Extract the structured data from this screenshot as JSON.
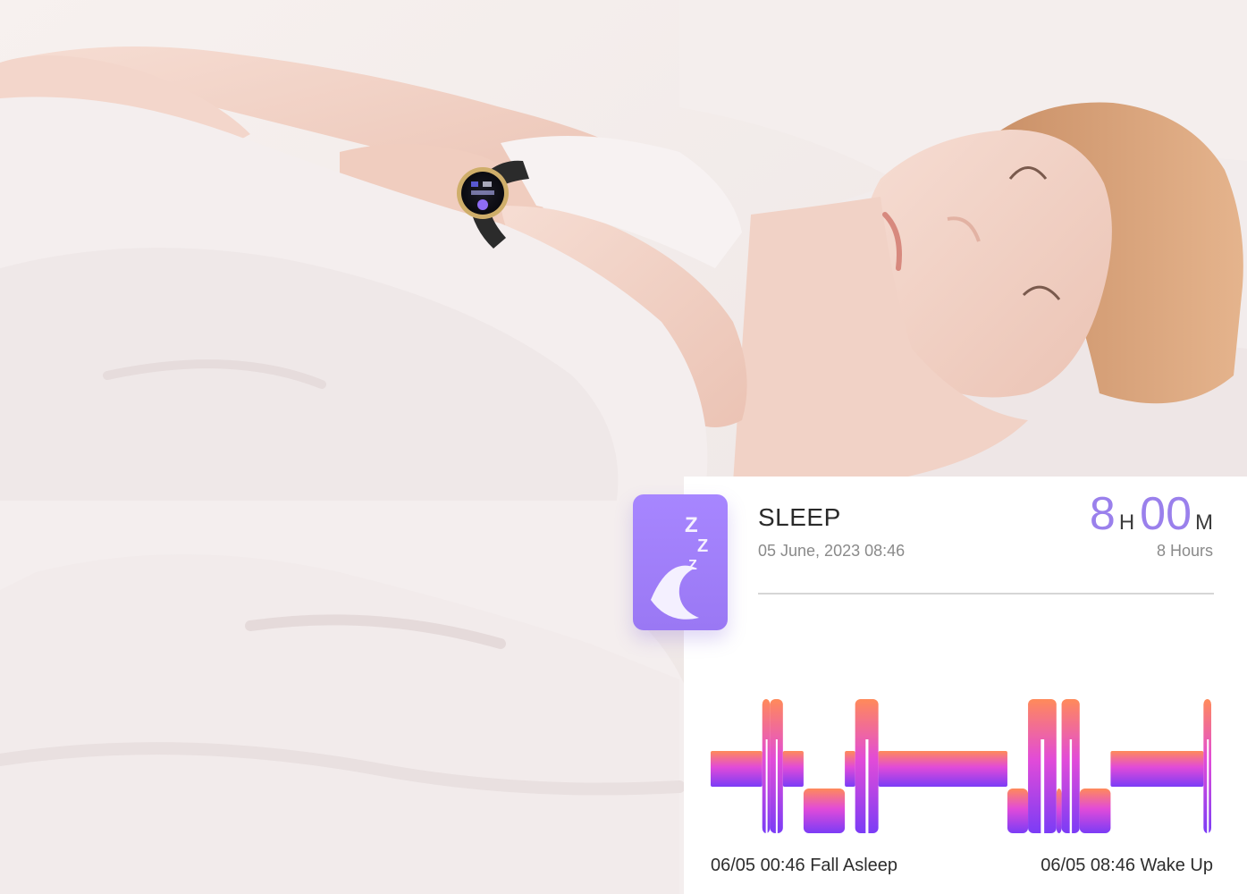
{
  "sleep_card": {
    "title": "SLEEP",
    "date": "05 June, 2023 08:46",
    "hours_value": "8",
    "hours_unit": "H",
    "minutes_value": "00",
    "minutes_unit": "M",
    "duration_text": "8 Hours",
    "fall_asleep_label": "06/05 00:46 Fall Asleep",
    "wake_up_label": "06/05 08:46 Wake Up"
  },
  "colors": {
    "accent_purple": "#9a80ec",
    "badge_purple": "#a786ff",
    "chart_top": "#ff8a5a",
    "chart_mid": "#e24bd8",
    "chart_bottom": "#7b3cf6"
  },
  "icons": {
    "badge": "moon-sleep-icon",
    "watch": "smartwatch"
  },
  "chart_data": {
    "type": "area",
    "stages_order_top_to_bottom": [
      "awake",
      "light",
      "deep"
    ],
    "segments": [
      {
        "stage": "light",
        "duration": 0.1
      },
      {
        "stage": "awake",
        "duration": 0.015
      },
      {
        "stage": "awake",
        "duration": 0.025
      },
      {
        "stage": "light",
        "duration": 0.04
      },
      {
        "stage": "deep",
        "duration": 0.08
      },
      {
        "stage": "light",
        "duration": 0.02
      },
      {
        "stage": "awake",
        "duration": 0.045
      },
      {
        "stage": "light",
        "duration": 0.25
      },
      {
        "stage": "deep",
        "duration": 0.04
      },
      {
        "stage": "awake",
        "duration": 0.055
      },
      {
        "stage": "deep",
        "duration": 0.01
      },
      {
        "stage": "awake",
        "duration": 0.035
      },
      {
        "stage": "deep",
        "duration": 0.06
      },
      {
        "stage": "light",
        "duration": 0.18
      },
      {
        "stage": "awake",
        "duration": 0.015
      }
    ]
  }
}
